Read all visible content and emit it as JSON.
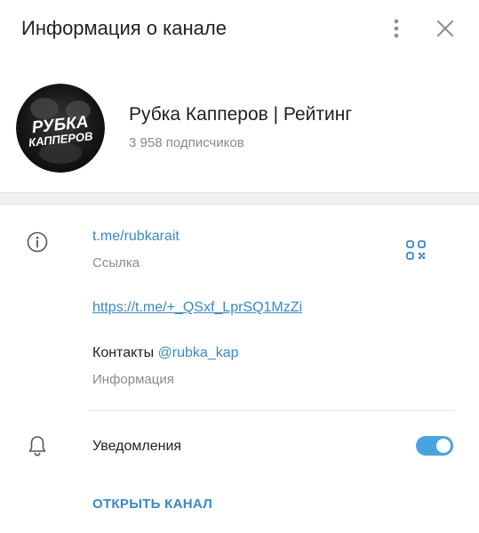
{
  "header": {
    "title": "Информация о канале",
    "menu_icon": "vertical-dots-icon",
    "close_icon": "close-icon"
  },
  "channel": {
    "avatar_line1": "РУБКА",
    "avatar_line2": "КАППЕРОВ",
    "name": "Рубка Капперов | Рейтинг",
    "subscribers": "3 958 подписчиков"
  },
  "info": {
    "icon": "info-icon",
    "public_link": "t.me/rubkarait",
    "public_link_caption": "Ссылка",
    "qr_icon": "qr-code-icon",
    "invite_link": "https://t.me/+_QSxf_LprSQ1MzZi",
    "contacts_prefix": "Контакты ",
    "contacts_handle": "@rubka_kap",
    "description_caption": "Информация"
  },
  "notifications": {
    "icon": "bell-icon",
    "label": "Уведомления",
    "enabled": true
  },
  "actions": {
    "open_channel_label": "ОТКРЫТЬ КАНАЛ"
  },
  "colors": {
    "accent": "#3a88c6",
    "toggle_on": "#4aa3df",
    "muted_text": "#8a8a8a",
    "primary_text": "#1f1f1f"
  }
}
